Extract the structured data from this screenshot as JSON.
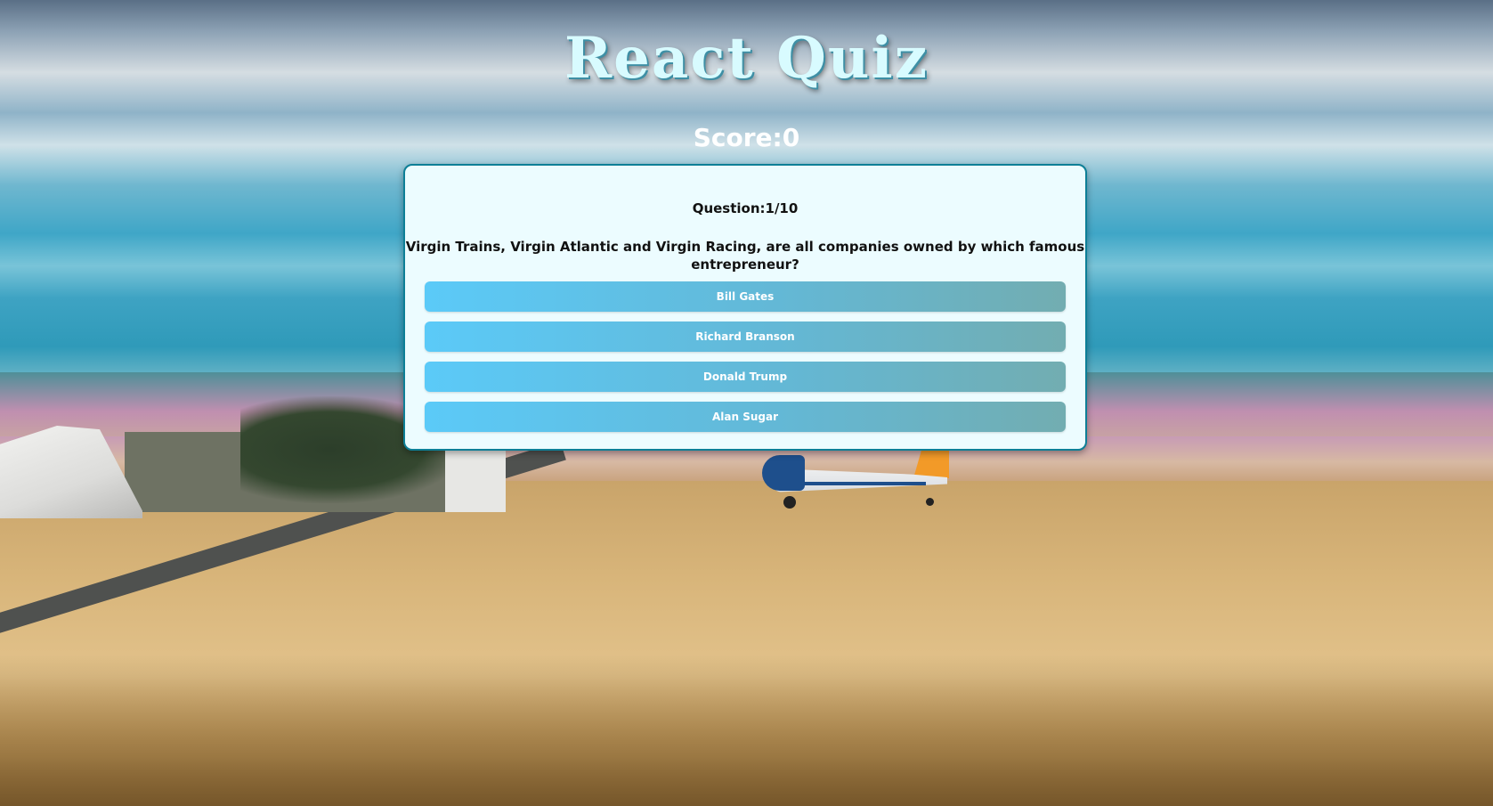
{
  "app": {
    "title": "React Quiz",
    "score_text": "Score:0"
  },
  "quiz": {
    "question_count": "Question:1/10",
    "question": "Virgin Trains, Virgin Atlantic and Virgin Racing, are all companies owned by which famous entrepreneur?",
    "answers": [
      {
        "label": "Bill Gates"
      },
      {
        "label": "Richard Branson"
      },
      {
        "label": "Donald Trump"
      },
      {
        "label": "Alan Sugar"
      }
    ]
  },
  "colors": {
    "card_background": "#ecfcff",
    "card_border": "#0d7f97",
    "button_gradient_start": "#5bcaf8",
    "button_gradient_end": "#72adb1",
    "title_color": "#d8fbff"
  }
}
